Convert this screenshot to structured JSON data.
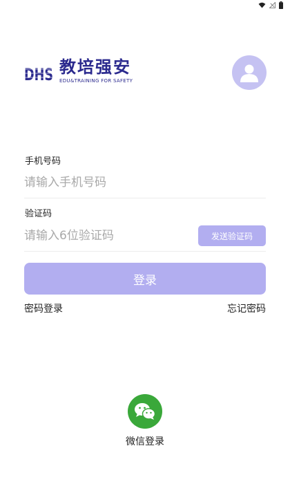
{
  "status_bar": {
    "icons": [
      "wifi-icon",
      "signal-icon",
      "battery-icon"
    ]
  },
  "brand": {
    "logo_letters": "DHS",
    "name": "教培强安",
    "tagline": "EDU&TRAINING FOR SAFETY"
  },
  "avatar": {
    "icon": "user-icon"
  },
  "phone": {
    "label": "手机号码",
    "placeholder": "请输入手机号码",
    "value": ""
  },
  "code": {
    "label": "验证码",
    "placeholder": "请输入6位验证码",
    "value": "",
    "send_button": "发送验证码"
  },
  "login_button": "登录",
  "links": {
    "password_login": "密码登录",
    "forgot_password": "忘记密码"
  },
  "wechat": {
    "label": "微信登录",
    "icon": "wechat-icon"
  },
  "colors": {
    "primary_disabled": "#b2aef0",
    "brand": "#2b2a8e",
    "avatar_bg": "#c5c2f2",
    "wechat": "#3aa83a"
  }
}
